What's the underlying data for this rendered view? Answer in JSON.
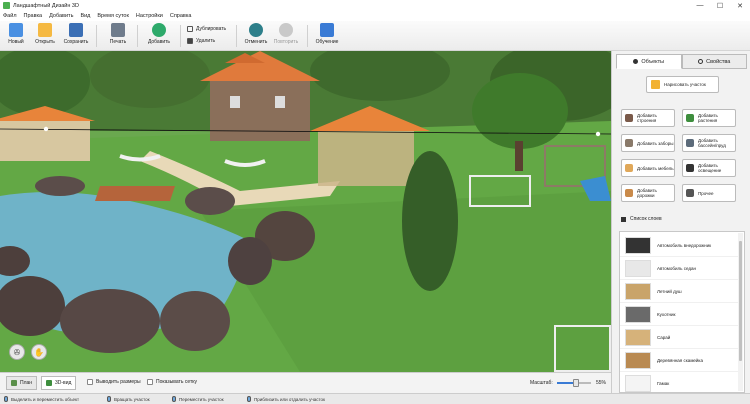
{
  "window": {
    "title": "Ландшафтный Дизайн 3D",
    "controls": [
      "—",
      "☐",
      "✕"
    ]
  },
  "menu": [
    "Файл",
    "Правка",
    "Добавить",
    "Вид",
    "Время суток",
    "Настройки",
    "Справка"
  ],
  "toolbar": {
    "new": "Новый",
    "open": "Открыть",
    "save": "Сохранить",
    "print": "Печать",
    "add": "Добавить",
    "duplicate": "Дублировать",
    "delete": "Удалить",
    "undo": "Отменить",
    "redo": "Повторить",
    "learn": "Обучение"
  },
  "panel": {
    "tabs": [
      "Объекты",
      "Свойства"
    ],
    "draw_area": "Нарисовать участок",
    "buttons": [
      "Добавить строения",
      "Добавить растения",
      "Добавить заборы",
      "Добавить бассейн/пруд",
      "Добавить мебель",
      "Добавить освещение",
      "Добавить дорожки",
      "Прочее"
    ],
    "layers_title": "Список слоев",
    "layers": [
      "Автомобиль внедорожник",
      "Автомобиль седан",
      "Летний душ",
      "Кухотник",
      "Сарай",
      "Деревянная скамейка",
      "Гамак"
    ]
  },
  "viewbar": {
    "plan": "План",
    "view3d": "3D-вид",
    "show_sizes": "Выводить размеры",
    "show_grid": "Показывать сетку",
    "zoom_label": "Масштаб:",
    "zoom_value": "55%",
    "zoom_fraction": 0.55
  },
  "status": {
    "hints": [
      "Выделить и переместить объект",
      "Вращать участок",
      "Переместить участок",
      "Приблизить или отдалить участок"
    ]
  },
  "colors": {
    "accent_blue": "#3a7bd5",
    "add_green": "#2eaa6b",
    "grass": "#6aa84f"
  }
}
